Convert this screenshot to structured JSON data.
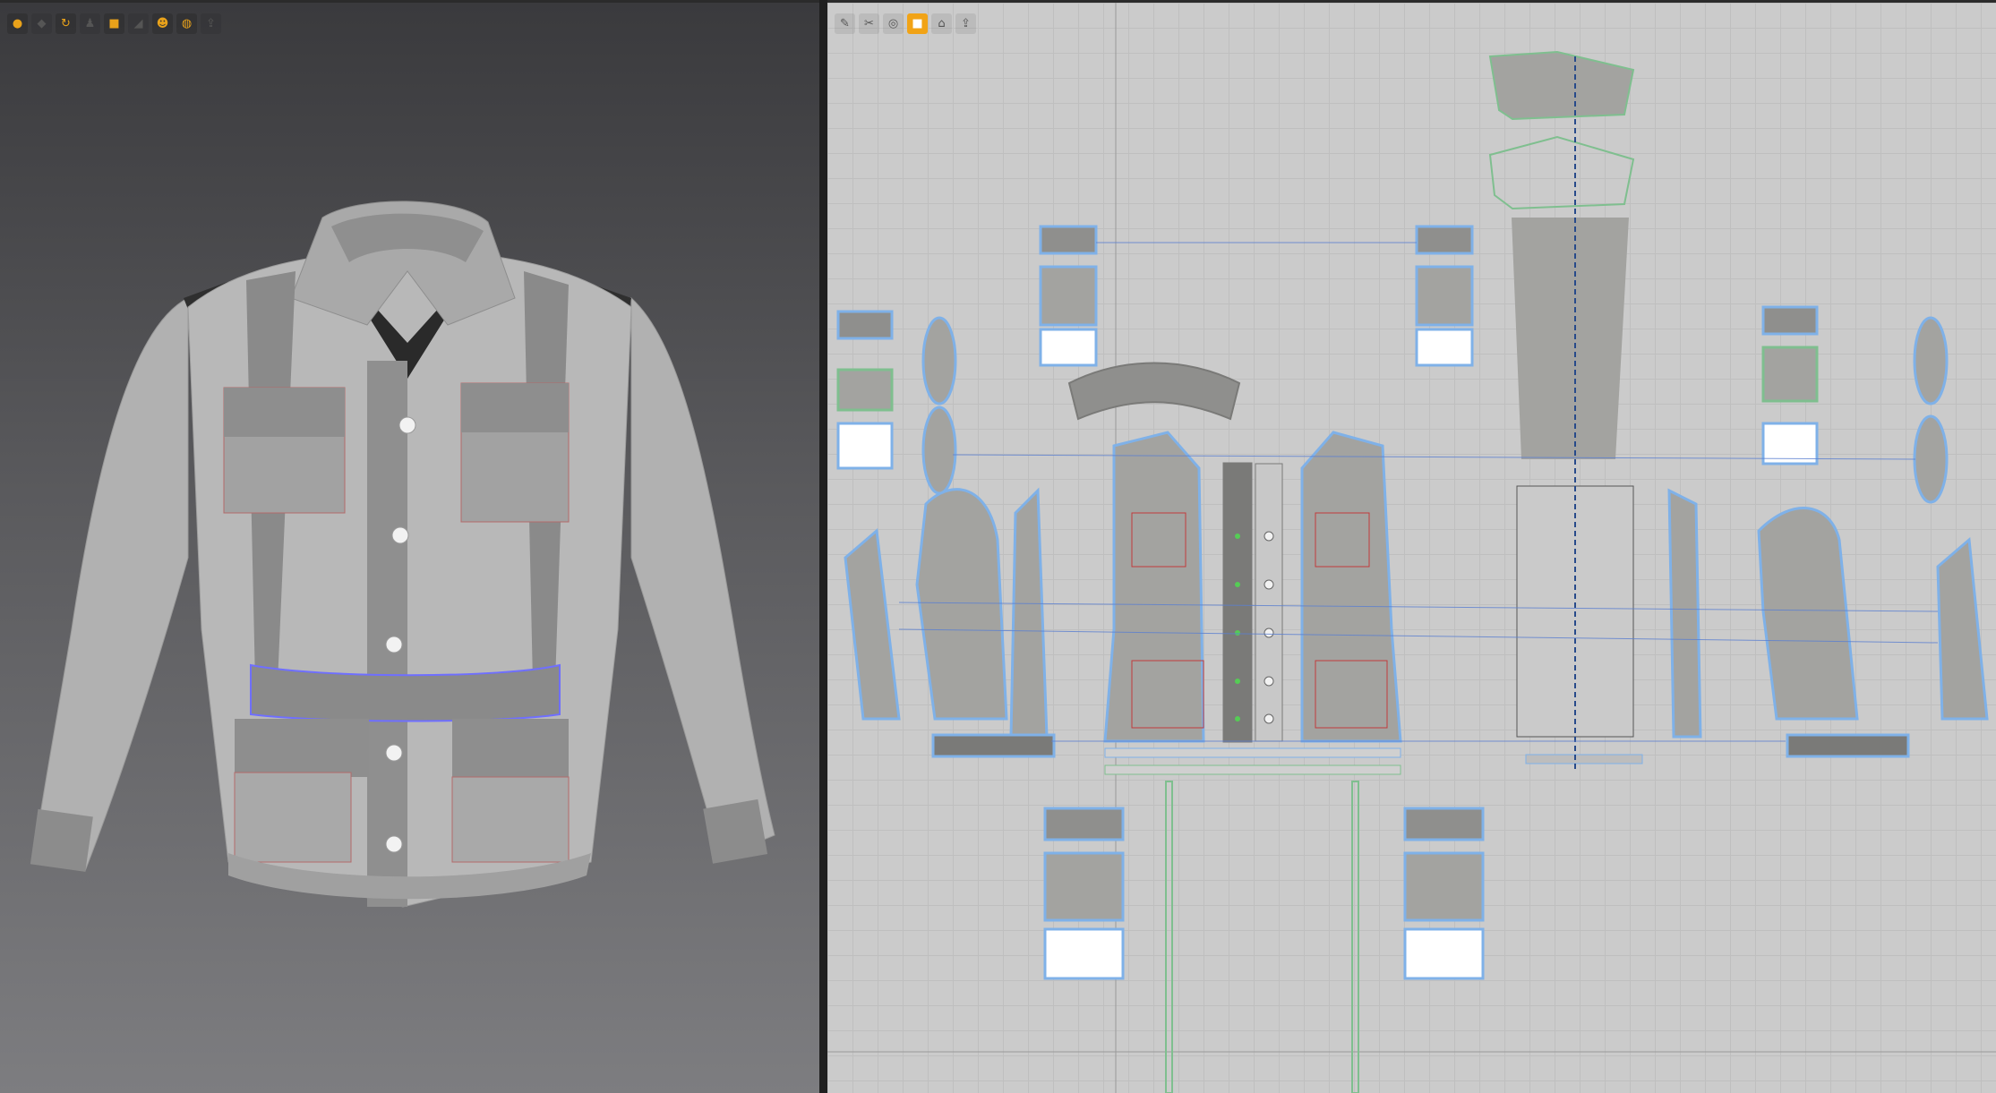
{
  "window": {
    "panes": [
      "3d-viewport",
      "2d-pattern-window"
    ]
  },
  "toolbar3d": {
    "tools": [
      {
        "icon": "avatar-head-icon"
      },
      {
        "icon": "garment-icon"
      },
      {
        "icon": "sync-icon"
      },
      {
        "icon": "avatar-figure-icon"
      },
      {
        "icon": "texture-icon"
      },
      {
        "icon": "fabric-fold-icon"
      },
      {
        "icon": "skin-icon"
      },
      {
        "icon": "globe-icon"
      },
      {
        "icon": "export-icon"
      }
    ]
  },
  "toolbar2d": {
    "tools": [
      {
        "icon": "pencil-icon"
      },
      {
        "icon": "pattern-edit-icon"
      },
      {
        "icon": "seam-icon"
      },
      {
        "icon": "texture-icon",
        "active": true
      },
      {
        "icon": "lock-icon"
      },
      {
        "icon": "export-icon"
      }
    ]
  },
  "colors": {
    "garment": "#b4b4b4",
    "garment_dark": "#8a8a8a",
    "belt_outline": "#6f6fff",
    "pattern_fill": "#a3a3a0",
    "pattern_dark": "#7a7a78",
    "pattern_outline": "#7fb1e8",
    "seam_red": "#c23b3b",
    "seam_green": "#7fbf8f",
    "toolbar_accent": "#f1a316"
  }
}
